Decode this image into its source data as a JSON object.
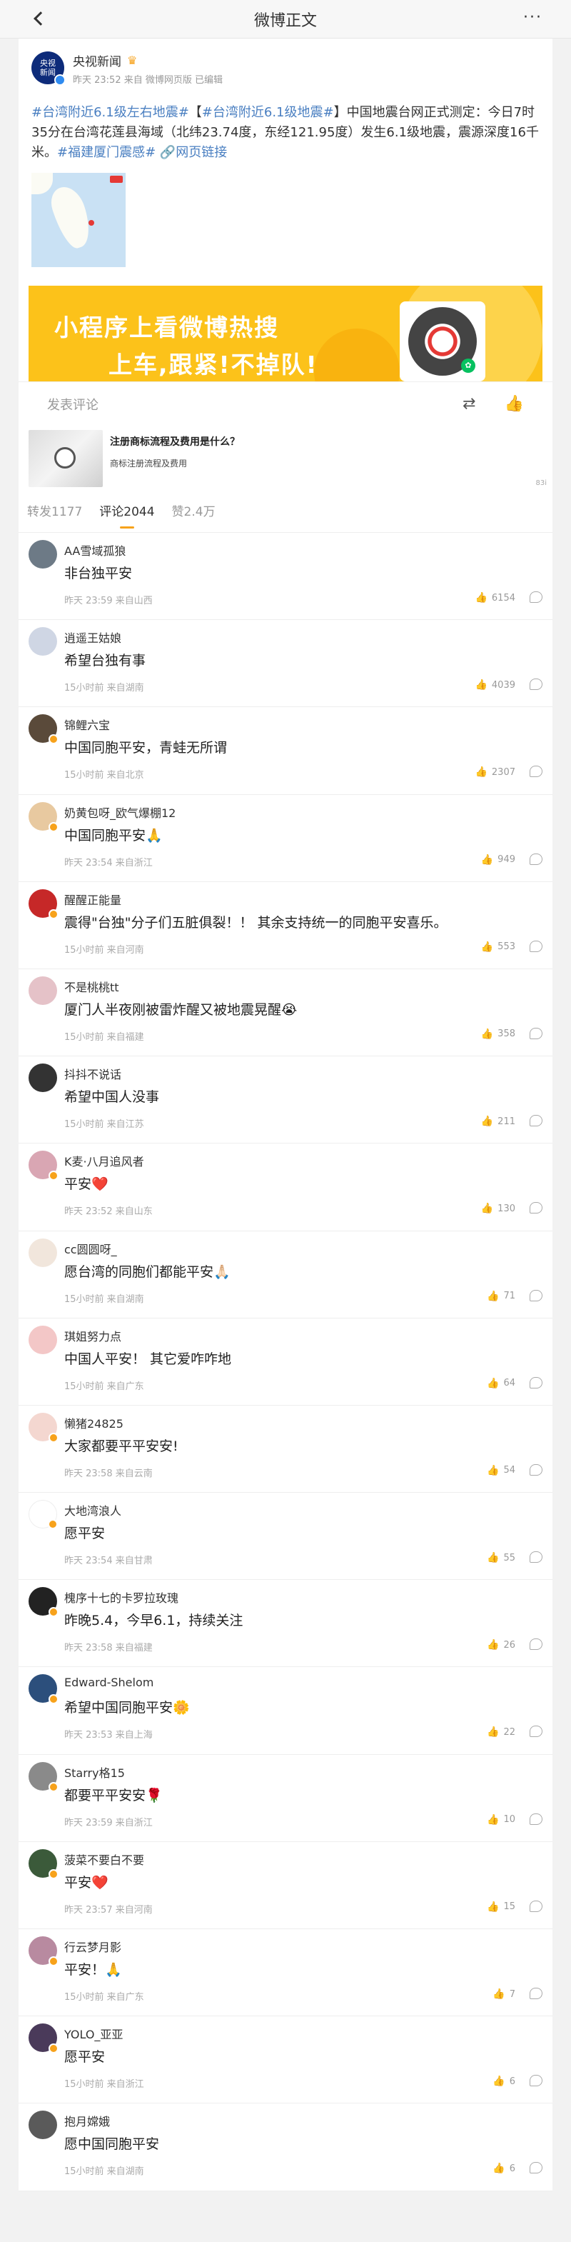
{
  "nav": {
    "title": "微博正文"
  },
  "post": {
    "author": "央视新闻",
    "avatar_text": "央视\n新闻",
    "meta": "昨天 23:52 来自 微博网页版 已编辑",
    "text_parts": [
      {
        "text": "#台湾附近6.1级左右地震#",
        "tag": true
      },
      {
        "text": "【",
        "tag": false
      },
      {
        "text": "#台湾附近6.1级地震#",
        "tag": true
      },
      {
        "text": "】中国地震台网正式测定：今日7时35分在台湾花莲县海域（北纬23.74度，东经121.95度）发生6.1级地震，震源深度16千米。",
        "tag": false
      },
      {
        "text": "#福建厦门震感#",
        "tag": true
      },
      {
        "text": " 🔗网页链接",
        "tag": true
      }
    ]
  },
  "banner": {
    "line1": "小程序上看微博热搜",
    "line2": "上车,跟紧!不掉队!"
  },
  "comment_bar": {
    "placeholder": "发表评论"
  },
  "ad": {
    "title": "注册商标流程及费用是什么？",
    "subtitle": "商标注册流程及费用",
    "badge": "83i"
  },
  "tabs": [
    {
      "label": "转发1177",
      "active": false
    },
    {
      "label": "评论2044",
      "active": true
    },
    {
      "label": "赞2.4万",
      "active": false
    }
  ],
  "comments": [
    {
      "name": "AA雪域孤狼",
      "text": "非台独平安",
      "time": "昨天 23:59 来自山西",
      "likes": "6154",
      "avatar_color": "#6d7a86",
      "verified": false
    },
    {
      "name": "逍遥王姑娘",
      "text": "希望台独有事",
      "time": "15小时前 来自湖南",
      "likes": "4039",
      "avatar_color": "#cfd6e4",
      "verified": false
    },
    {
      "name": "锦鲤六宝",
      "text": "中国同胞平安，青蛙无所谓",
      "time": "15小时前 来自北京",
      "likes": "2307",
      "avatar_color": "#5a4a3a",
      "verified": true
    },
    {
      "name": "奶黄包呀_欧气爆棚12",
      "text": "中国同胞平安🙏",
      "time": "昨天 23:54 来自浙江",
      "likes": "949",
      "avatar_color": "#e8c9a0",
      "verified": true
    },
    {
      "name": "醒醒正能量",
      "text": "震得\"台独\"分子们五脏俱裂！！ 其余支持统一的同胞平安喜乐。",
      "time": "15小时前 来自河南",
      "likes": "553",
      "avatar_color": "#c62828",
      "verified": true
    },
    {
      "name": "不是桃桃tt",
      "text": "厦门人半夜刚被雷炸醒又被地震晃醒😭",
      "time": "15小时前 来自福建",
      "likes": "358",
      "avatar_color": "#e5c2c8",
      "verified": false
    },
    {
      "name": "抖抖不说话",
      "text": "希望中国人没事",
      "time": "15小时前 来自江苏",
      "likes": "211",
      "avatar_color": "#333333",
      "verified": false
    },
    {
      "name": "K麦·八月追风者",
      "text": "平安❤️",
      "time": "昨天 23:52 来自山东",
      "likes": "130",
      "avatar_color": "#d9a6b3",
      "verified": true
    },
    {
      "name": "cc圆圆呀_",
      "text": "愿台湾的同胞们都能平安🙏🏻",
      "time": "15小时前 来自湖南",
      "likes": "71",
      "avatar_color": "#f1e6dc",
      "verified": false
    },
    {
      "name": "琪姐努力点",
      "text": "中国人平安！ 其它爱咋咋地",
      "time": "15小时前 来自广东",
      "likes": "64",
      "avatar_color": "#f3c7c7",
      "verified": false
    },
    {
      "name": "懒猪24825",
      "text": "大家都要平平安安!",
      "time": "昨天 23:58 来自云南",
      "likes": "54",
      "avatar_color": "#f4d7d0",
      "verified": true
    },
    {
      "name": "大地湾浪人",
      "text": "愿平安",
      "time": "昨天 23:54 来自甘肃",
      "likes": "55",
      "avatar_color": "#ffffff",
      "verified": true
    },
    {
      "name": "槐序十七的卡罗拉玫瑰",
      "text": "昨晚5.4，今早6.1，持续关注",
      "time": "昨天 23:58 来自福建",
      "likes": "26",
      "avatar_color": "#222222",
      "verified": true
    },
    {
      "name": "Edward-Shelom",
      "text": "希望中国同胞平安🌼",
      "time": "昨天 23:53 来自上海",
      "likes": "22",
      "avatar_color": "#2c4f7c",
      "verified": true
    },
    {
      "name": "Starry格15",
      "text": "都要平平安安🌹",
      "time": "昨天 23:59 来自浙江",
      "likes": "10",
      "avatar_color": "#8a8a8a",
      "verified": true
    },
    {
      "name": "菠菜不要白不要",
      "text": "平安❤️",
      "time": "昨天 23:57 来自河南",
      "likes": "15",
      "avatar_color": "#3b5a3a",
      "verified": true
    },
    {
      "name": "行云梦月影",
      "text": "平安！🙏",
      "time": "15小时前 来自广东",
      "likes": "7",
      "avatar_color": "#b88aa0",
      "verified": true
    },
    {
      "name": "YOLO_亚亚",
      "text": "愿平安",
      "time": "15小时前 来自浙江",
      "likes": "6",
      "avatar_color": "#4a3a5a",
      "verified": true
    },
    {
      "name": "抱月嫦娥",
      "text": "愿中国同胞平安",
      "time": "15小时前 来自湖南",
      "likes": "6",
      "avatar_color": "#5a5a5a",
      "verified": false
    }
  ]
}
